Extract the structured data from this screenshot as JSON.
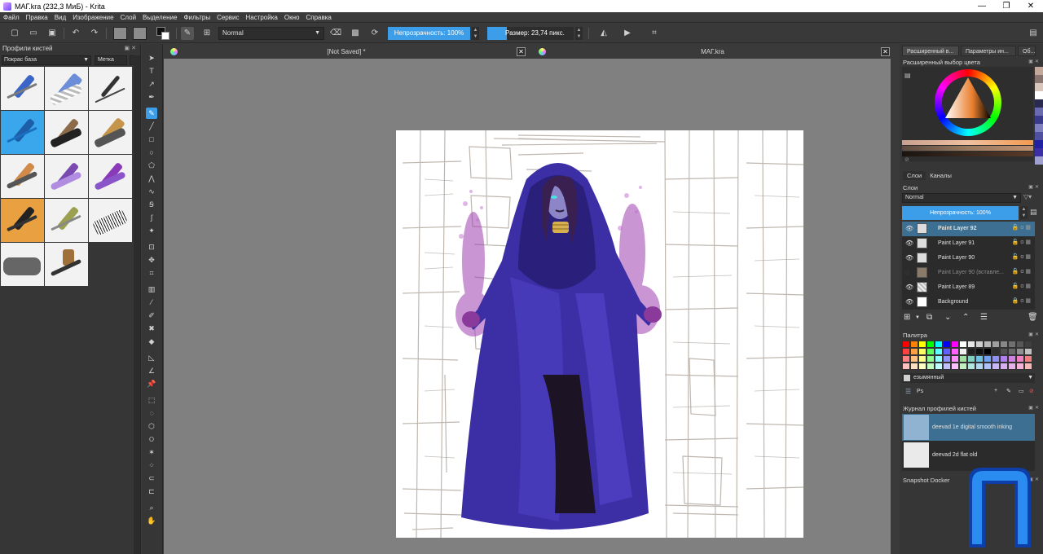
{
  "window": {
    "title": "МАГ.kra (232,3 МиБ)  - Krita",
    "controls": [
      "—",
      "❐",
      "✕"
    ]
  },
  "menu": [
    "Файл",
    "Правка",
    "Вид",
    "Изображение",
    "Слой",
    "Выделение",
    "Фильтры",
    "Сервис",
    "Настройка",
    "Окно",
    "Справка"
  ],
  "toolbar": {
    "blend_mode": "Normal",
    "opacity_label": "Непрозрачность: 100%",
    "size_label": "Размер: 23,74 пикс.",
    "size_fraction": 0.23
  },
  "brush_docker": {
    "title": "Профили кистей",
    "tag_filter": "Покрас база",
    "tag_button": "Метка"
  },
  "documents": {
    "tabs": [
      {
        "title": "[Not Saved]  *"
      },
      {
        "title": "МАГ.kra"
      }
    ]
  },
  "right": {
    "top_tabs": [
      "Расширенный в...",
      "Параметры ин...",
      "Об..."
    ],
    "color_selector_title": "Расширенный выбор цвета",
    "layer_tabs": [
      "Слои",
      "Каналы"
    ],
    "layers_title": "Слои",
    "layers_blend": "Normal",
    "layers_opacity": "Непрозрачность:  100%",
    "layers": [
      {
        "name": "Paint Layer 92",
        "selected": true,
        "visible": true
      },
      {
        "name": "Paint Layer 91",
        "selected": false,
        "visible": true
      },
      {
        "name": "Paint Layer 90",
        "selected": false,
        "visible": true
      },
      {
        "name": "Paint Layer 90 (вставле...",
        "selected": false,
        "visible": false
      },
      {
        "name": "Paint Layer 89",
        "selected": false,
        "visible": true
      },
      {
        "name": "Background",
        "selected": false,
        "visible": true
      }
    ],
    "palette_title": "Палитра",
    "palette_name": "езымянный",
    "palette_set": "Ps",
    "history_title": "Журнал профилей кистей",
    "history": [
      {
        "name": "deevad 1e digital smooth inking"
      },
      {
        "name": "deevad 2d flat old"
      }
    ],
    "snapshot_title": "Snapshot Docker"
  },
  "colors": {
    "accent": "#3c9de8",
    "selected_row": "#3d6f92",
    "canvas_bg": "#808080"
  }
}
